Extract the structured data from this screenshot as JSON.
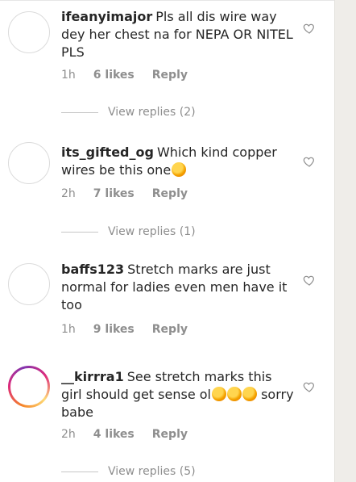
{
  "comments": [
    {
      "username": "ifeanyimajor",
      "text": "Pls all dis wire way dey her chest na for NEPA OR NITEL PLS",
      "emoji_count": 0,
      "time": "1h",
      "likes": "6 likes",
      "reply": "Reply",
      "view_replies": "View replies (2)",
      "story_ring": false
    },
    {
      "username": "its_gifted_og",
      "text": "Which kind copper wires be this one",
      "emoji_count": 1,
      "time": "2h",
      "likes": "7 likes",
      "reply": "Reply",
      "view_replies": "View replies (1)",
      "story_ring": false
    },
    {
      "username": "baffs123",
      "text": "Stretch marks are just normal for ladies even men have it too",
      "emoji_count": 0,
      "time": "1h",
      "likes": "9 likes",
      "reply": "Reply",
      "view_replies": "",
      "story_ring": false
    },
    {
      "username": "__kirrra1",
      "text": "See stretch marks this girl should get sense ol",
      "text_after": "sorry babe",
      "emoji_count": 3,
      "time": "2h",
      "likes": "4 likes",
      "reply": "Reply",
      "view_replies": "View replies (5)",
      "story_ring": true
    }
  ],
  "icons": {
    "like": "heart-outline-icon",
    "emoji": "laughing-crying-emoji"
  },
  "colors": {
    "text": "#262626",
    "muted": "#8e8e8e",
    "story_ring": [
      "#f58529",
      "#dd2a7b",
      "#8134af"
    ]
  }
}
